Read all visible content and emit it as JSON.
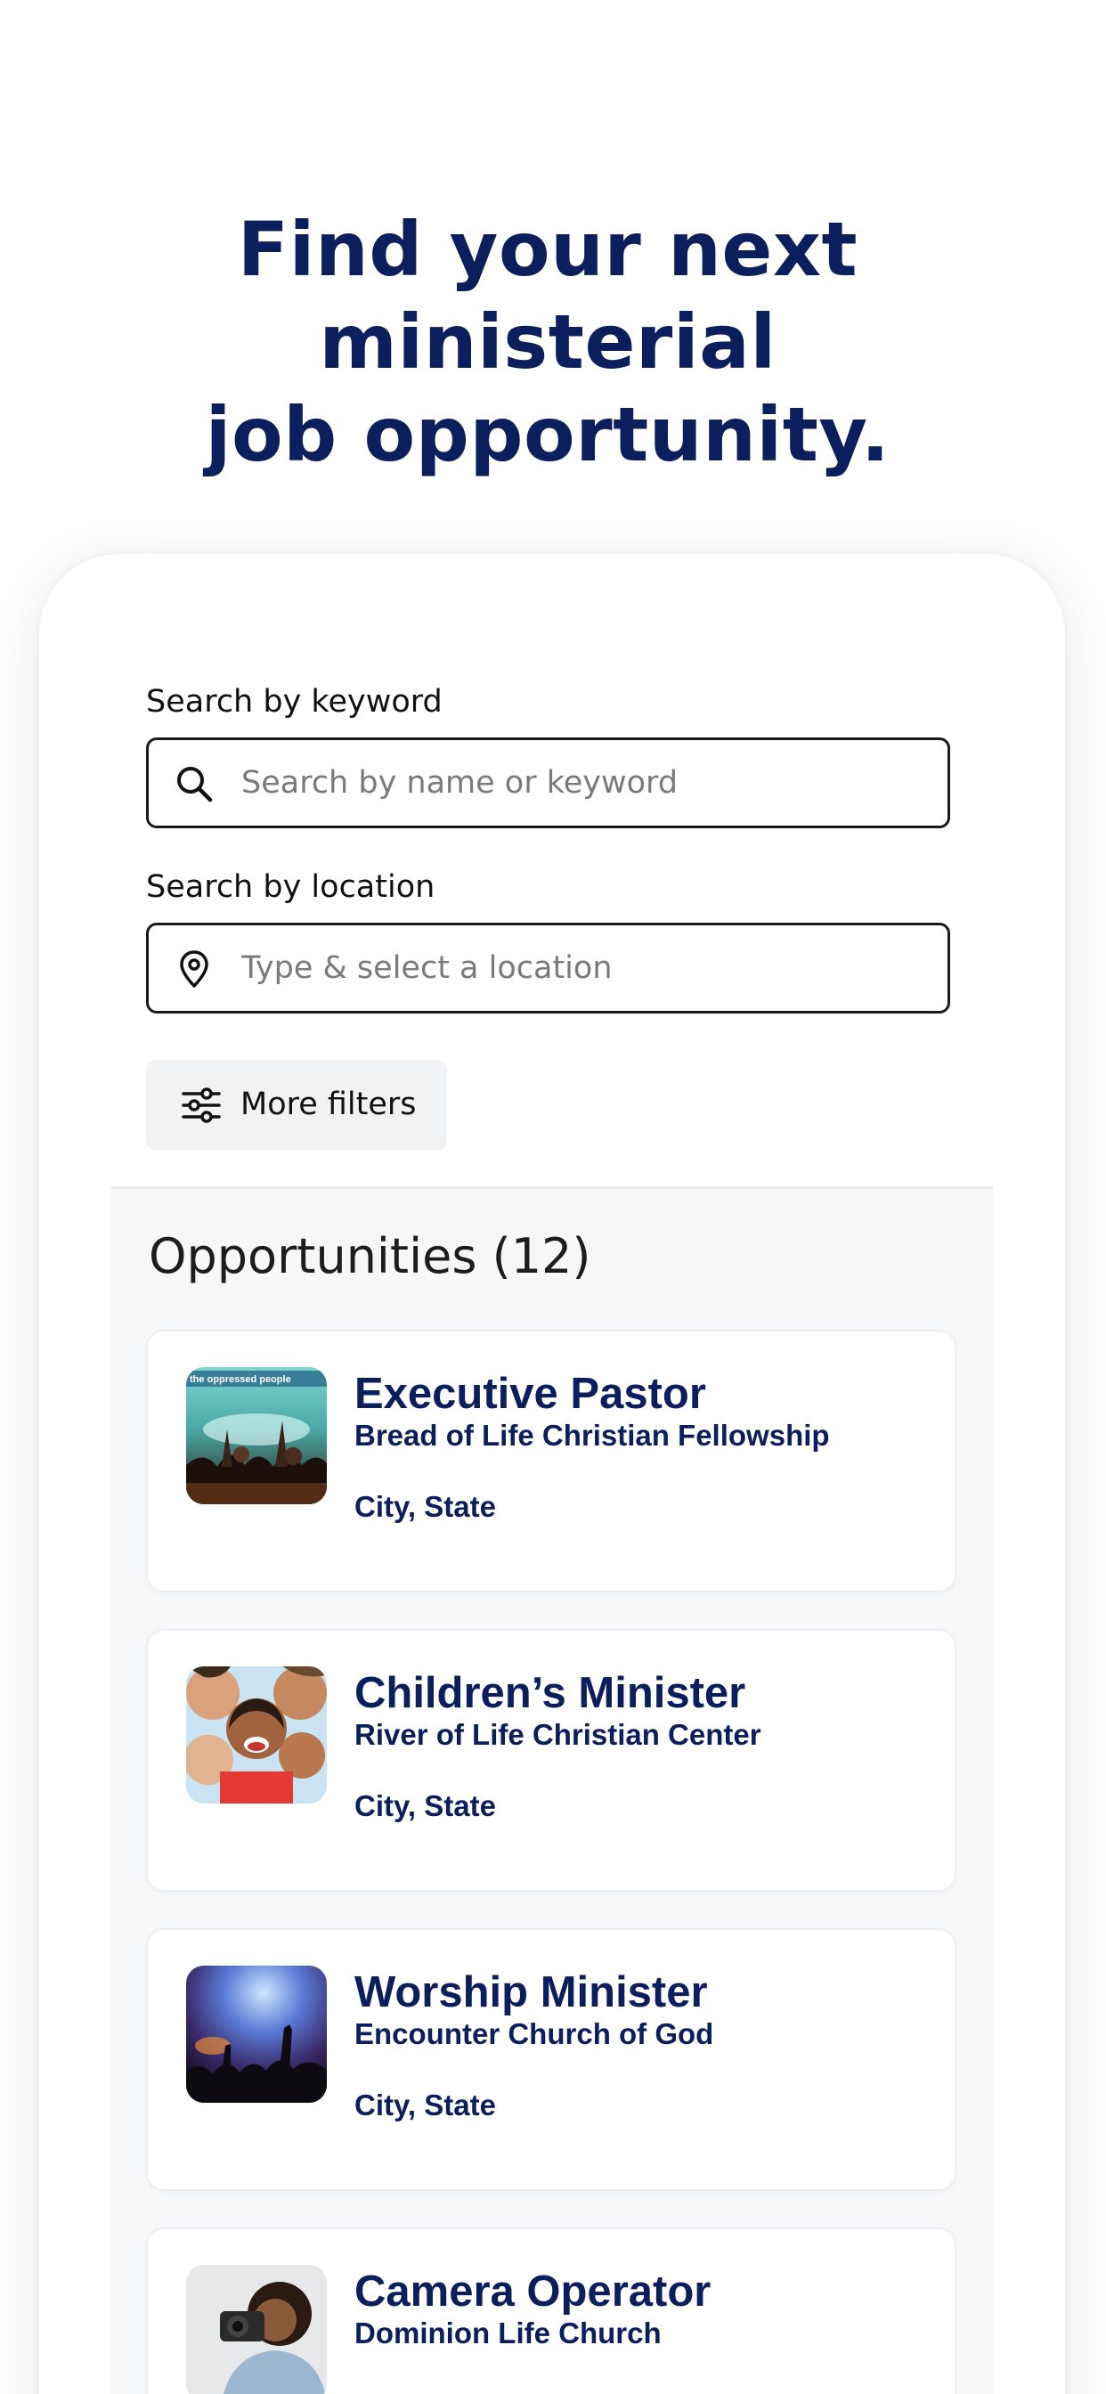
{
  "hero": {
    "title_line1": "Find your next ministerial",
    "title_line2": "job opportunity."
  },
  "search": {
    "keyword_label": "Search by keyword",
    "keyword_placeholder": "Search by name or keyword",
    "keyword_value": "",
    "location_label": "Search by location",
    "location_placeholder": "Type & select a location",
    "location_value": "",
    "more_filters_label": "More filters"
  },
  "results": {
    "title": "Opportunities (12)",
    "jobs": [
      {
        "title": "Executive Pastor",
        "organization": "Bread of Life Christian Fellowship",
        "location": "City, State",
        "thumb_icon": "worship-crowd-image",
        "thumb_banner": "the oppressed people"
      },
      {
        "title": "Children’s Minister",
        "organization": "River of Life Christian Center",
        "location": "City, State",
        "thumb_icon": "children-group-image"
      },
      {
        "title": "Worship Minister",
        "organization": "Encounter Church of God",
        "location": "City, State",
        "thumb_icon": "concert-lights-image"
      },
      {
        "title": "Camera Operator",
        "organization": "Dominion Life Church",
        "location": "",
        "thumb_icon": "photographer-image"
      }
    ]
  },
  "colors": {
    "brand_navy": "#0b1f5c",
    "results_bg": "#f6f7f9",
    "filters_bg": "#f1f2f4"
  }
}
